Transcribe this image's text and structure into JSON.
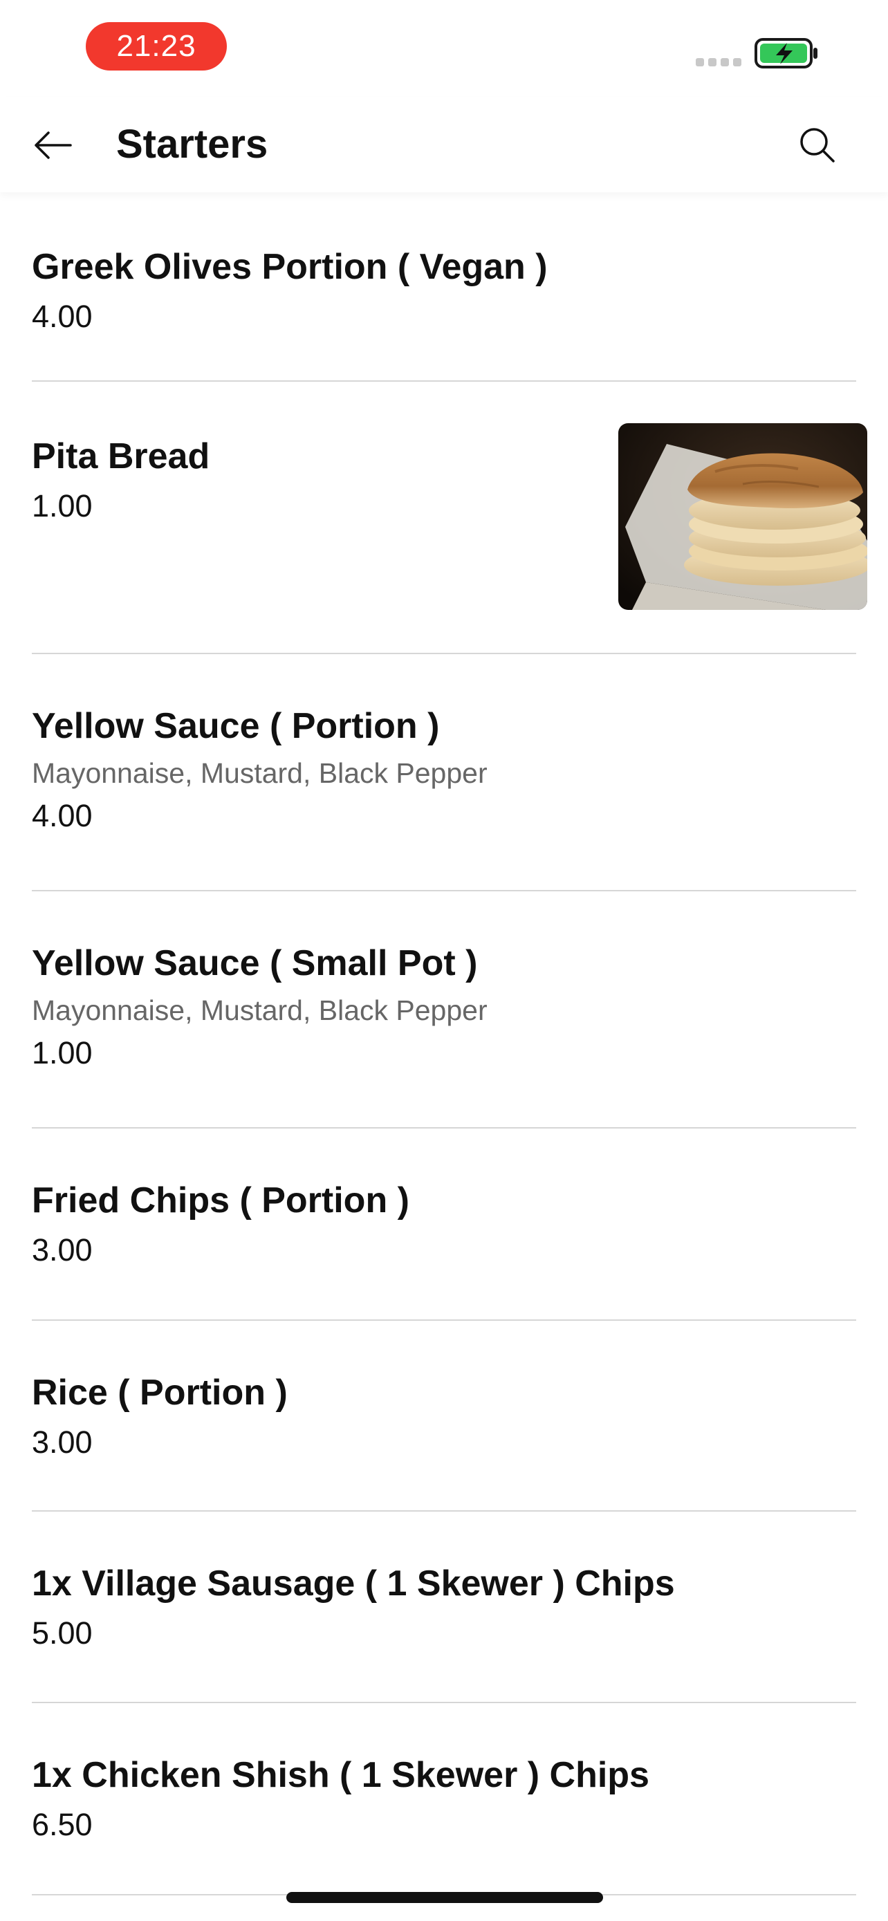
{
  "status_bar": {
    "time": "21:23",
    "time_pill_color": "#f2382d",
    "battery_icon": "battery-charging-icon",
    "battery_color": "#34c759"
  },
  "header": {
    "title": "Starters",
    "back_icon": "arrow-left-icon",
    "search_icon": "search-icon"
  },
  "menu_items": [
    {
      "name": "Greek Olives Portion ( Vegan )",
      "description": "",
      "price": "4.00",
      "has_image": false
    },
    {
      "name": "Pita Bread",
      "description": "",
      "price": "1.00",
      "has_image": true,
      "image_icon": "pita-bread-photo"
    },
    {
      "name": "Yellow Sauce ( Portion )",
      "description": "Mayonnaise, Mustard, Black Pepper",
      "price": "4.00",
      "has_image": false
    },
    {
      "name": "Yellow Sauce ( Small Pot )",
      "description": "Mayonnaise, Mustard, Black Pepper",
      "price": "1.00",
      "has_image": false
    },
    {
      "name": "Fried Chips ( Portion )",
      "description": "",
      "price": "3.00",
      "has_image": false
    },
    {
      "name": "Rice ( Portion )",
      "description": "",
      "price": "3.00",
      "has_image": false
    },
    {
      "name": "1x Village Sausage ( 1 Skewer ) Chips",
      "description": "",
      "price": "5.00",
      "has_image": false
    },
    {
      "name": "1x Chicken Shish ( 1 Skewer ) Chips",
      "description": "",
      "price": "6.50",
      "has_image": false
    }
  ]
}
